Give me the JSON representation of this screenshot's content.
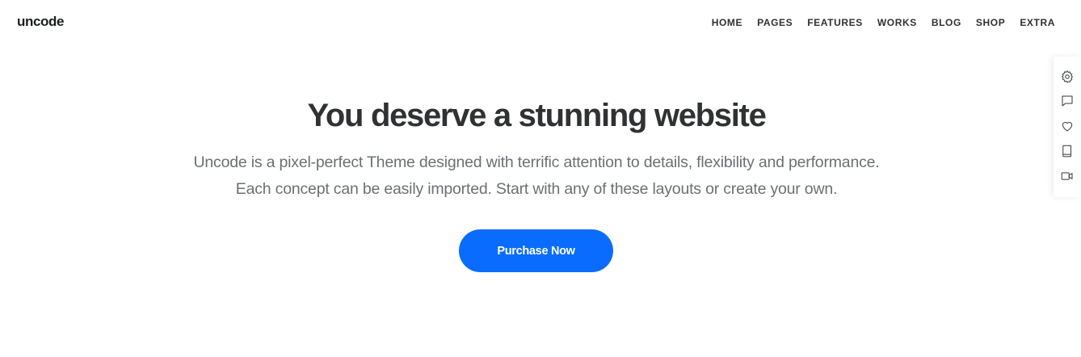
{
  "header": {
    "logo": "uncode",
    "nav": [
      "HOME",
      "PAGES",
      "FEATURES",
      "WORKS",
      "BLOG",
      "SHOP",
      "EXTRA"
    ]
  },
  "hero": {
    "title": "You deserve a stunning website",
    "line1": "Uncode is a pixel-perfect Theme designed with terrific attention to details, flexibility and performance.",
    "line2": "Each concept can be easily imported. Start with any of these layouts or create your own.",
    "cta_label": "Purchase Now"
  },
  "side_panel": {
    "icons": [
      "gear-icon",
      "comment-icon",
      "heart-icon",
      "book-icon",
      "video-camera-icon"
    ]
  },
  "colors": {
    "accent": "#0a6cff",
    "text": "#303133",
    "muted": "#6c7075",
    "background": "#ffffff"
  }
}
